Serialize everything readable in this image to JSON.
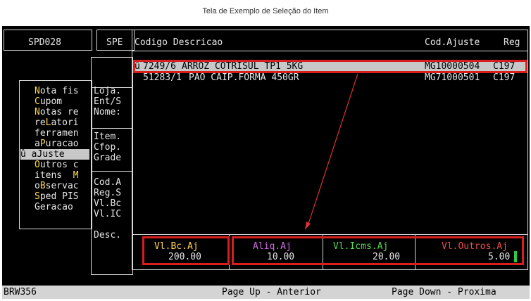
{
  "caption": "Tela de Exemplo de Seleção do Item",
  "top_left_box": "SPD028",
  "top_mid_box": "SPE",
  "menu": [
    {
      "hot": "N",
      "rest": "ota fis"
    },
    {
      "hot": "C",
      "rest": "upom"
    },
    {
      "hot": "N",
      "rest": "otas re"
    },
    {
      "pre": "re",
      "hot": "L",
      "rest": "atori"
    },
    {
      "pre": "ferramen",
      "hot": "",
      "rest": ""
    },
    {
      "pre": "a",
      "hot": "P",
      "rest": "uracao"
    },
    {
      "pre": "a",
      "hot": "J",
      "rest": "uste"
    },
    {
      "hot": "O",
      "rest": "utros c"
    },
    {
      "pre": "itens  ",
      "hot": "M",
      "rest": ""
    },
    {
      "pre": "o",
      "hot": "B",
      "rest": "servac"
    },
    {
      "hot": "S",
      "rest": "ped PIS"
    },
    {
      "pre": "Geracao",
      "hot": "",
      "rest": ""
    }
  ],
  "menu_selected_marker": "û",
  "fields": [
    "Loja.",
    "Ent/S",
    "Nome:",
    "Item.",
    "Cfop.",
    "Grade",
    "Cod.A",
    "Reg.S",
    "Vl.Bc",
    "Vl.IC",
    "Desc."
  ],
  "list_header": {
    "col1": "Codigo Descricao",
    "col2": "Cod.Ajuste",
    "col3": "Reg"
  },
  "rows": [
    {
      "marker": "û",
      "code": "7249/6",
      "desc": "ARROZ COTRISUL TP1 5KG",
      "ajuste": "MG10000504",
      "reg": "C197"
    },
    {
      "marker": "",
      "code": "51283/1",
      "desc": "PAO CAIP.FORMA 450GR",
      "ajuste": "MG71000501",
      "reg": "C197"
    }
  ],
  "totals": [
    {
      "label": "Vl.Bc.Aj",
      "value": "200.00",
      "color": "#ffd54a"
    },
    {
      "label": "Aliq.Aj",
      "value": "10.00",
      "color": "#d06be0"
    },
    {
      "label": "Vl.Icms.Aj",
      "value": "20.00",
      "color": "#4fdc4f"
    },
    {
      "label": "Vl.Outros.Aj",
      "value": "5.00",
      "color": "#ef4b4b"
    }
  ],
  "status": {
    "left": "BRW356",
    "mid": "Page Up - Anterior",
    "right": "Page Down - Proxima"
  }
}
